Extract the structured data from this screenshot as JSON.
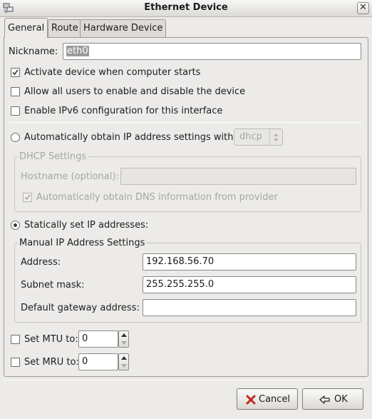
{
  "window": {
    "title": "Ethernet Device"
  },
  "tabs": [
    {
      "label": "General",
      "active": true
    },
    {
      "label": "Route",
      "active": false
    },
    {
      "label": "Hardware Device",
      "active": false
    }
  ],
  "general": {
    "nickname_label": "Nickname:",
    "nickname_value": "eth0",
    "activate_label": "Activate device when computer starts",
    "activate_checked": true,
    "allow_users_label": "Allow all users to enable and disable the device",
    "allow_users_checked": false,
    "ipv6_label": "Enable IPv6 configuration for this interface",
    "ipv6_checked": false,
    "auto_ip_label": "Automatically obtain IP address settings with:",
    "auto_ip_method": "dhcp",
    "dhcp_frame_title": "DHCP Settings",
    "hostname_label": "Hostname (optional):",
    "hostname_value": "",
    "auto_dns_label": "Automatically obtain DNS information from provider",
    "auto_dns_checked": true,
    "static_label": "Statically set IP addresses:",
    "static_selected": true,
    "manual_frame_title": "Manual IP Address Settings",
    "address_label": "Address:",
    "address_value": "192.168.56.70",
    "subnet_label": "Subnet mask:",
    "subnet_value": "255.255.255.0",
    "gateway_label": "Default gateway address:",
    "gateway_value": "",
    "mtu_label": "Set MTU to:",
    "mtu_value": "0",
    "mtu_checked": false,
    "mru_label": "Set MRU to:",
    "mru_value": "0",
    "mru_checked": false
  },
  "footer": {
    "cancel_label": "Cancel",
    "ok_label": "OK"
  },
  "icons": {
    "app": "network-card-icon",
    "close": "close-icon",
    "cancel": "cancel-x-icon",
    "ok": "ok-hand-icon"
  }
}
